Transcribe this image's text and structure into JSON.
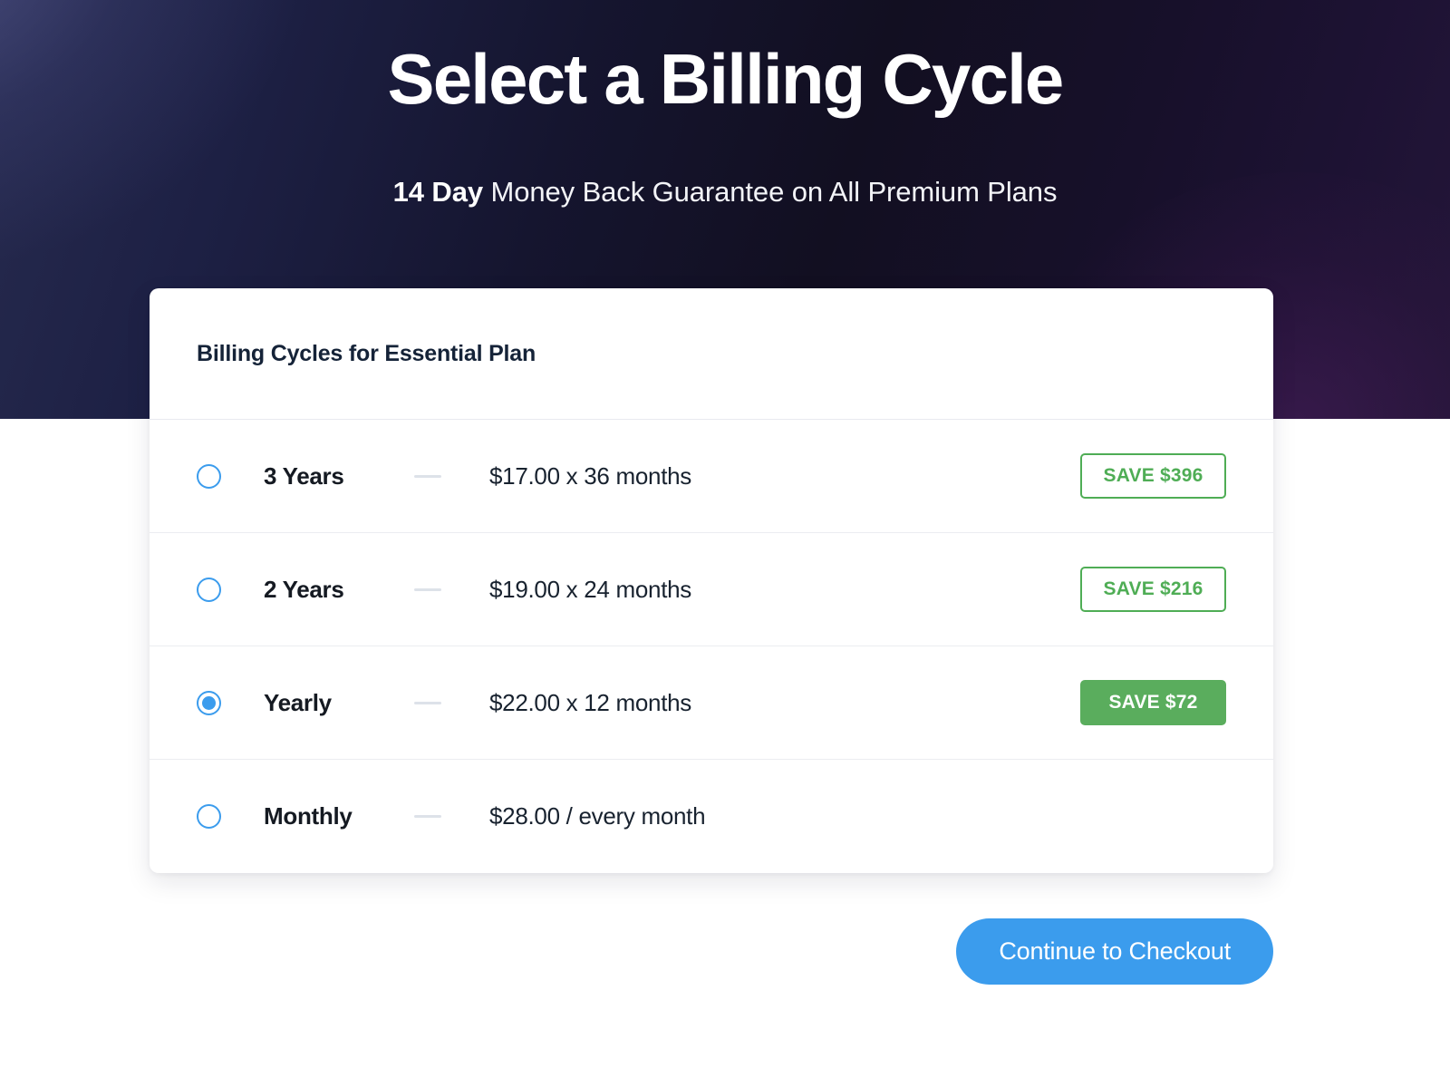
{
  "hero": {
    "title": "Select a Billing Cycle",
    "subtitle_lead": "14 Day",
    "subtitle_rest": " Money Back Guarantee on All Premium Plans",
    "bg_color_left": "#262a4e",
    "bg_color_right": "#241639"
  },
  "card": {
    "header_title": "Billing Cycles for Essential Plan",
    "rows": [
      {
        "label": "3 Years",
        "price": "$17.00 x 36 months",
        "badge": "SAVE $396",
        "selected": false,
        "badge_filled": false,
        "has_badge": true
      },
      {
        "label": "2 Years",
        "price": "$19.00 x 24 months",
        "badge": "SAVE $216",
        "selected": false,
        "badge_filled": false,
        "has_badge": true
      },
      {
        "label": "Yearly",
        "price": "$22.00 x 12 months",
        "badge": "SAVE $72",
        "selected": true,
        "badge_filled": true,
        "has_badge": true
      },
      {
        "label": "Monthly",
        "price": "$28.00 / every month",
        "badge": "",
        "selected": false,
        "badge_filled": false,
        "has_badge": false
      }
    ]
  },
  "cta": {
    "label": "Continue to Checkout",
    "color": "#3b9ced"
  },
  "colors": {
    "accent_blue": "#3b9ced",
    "save_green": "#4fad55",
    "save_green_filled": "#5aad5d",
    "text_dark": "#151a22",
    "heading_navy": "#152338"
  }
}
